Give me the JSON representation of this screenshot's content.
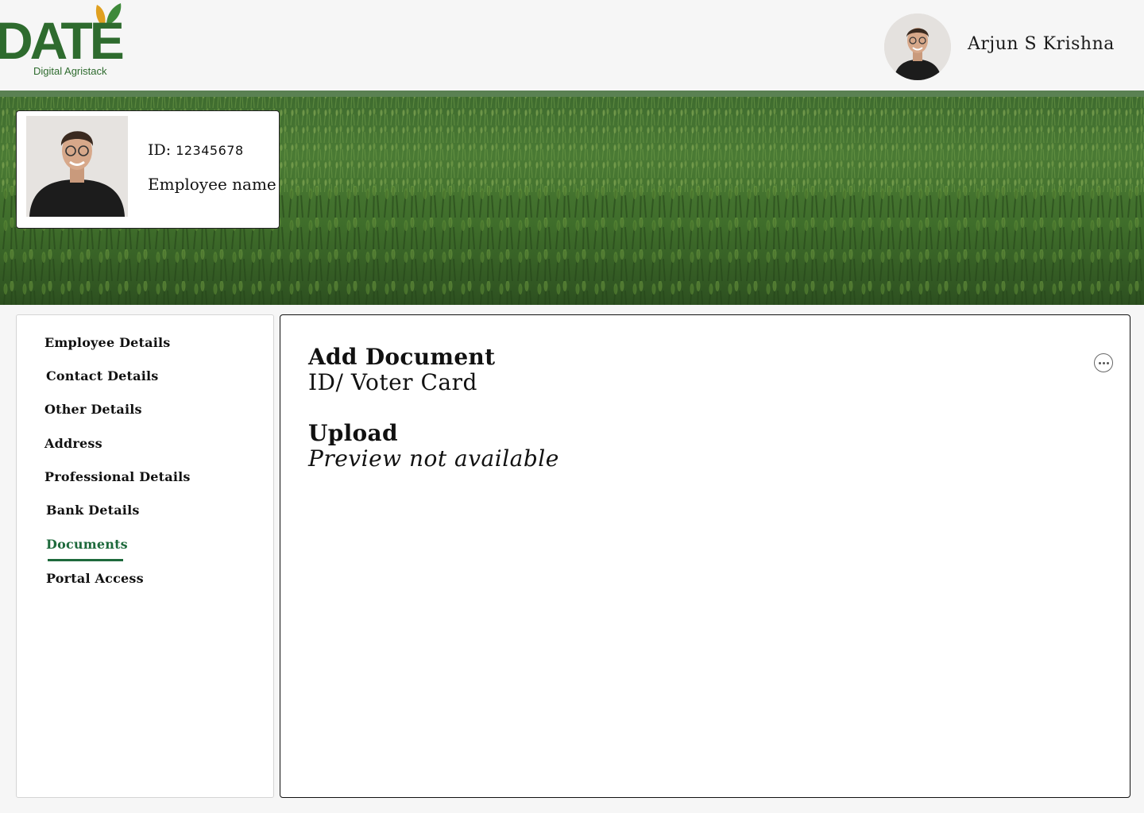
{
  "brand": {
    "logo_text": "DATE",
    "logo_subtitle": "Digital Agristack",
    "logo_color": "#2e6b2e",
    "leaf_colors": [
      "#e0a020",
      "#3e8a3a"
    ]
  },
  "header": {
    "user_name": "Arjun S Krishna",
    "avatar_icon": "user-avatar"
  },
  "profile_card": {
    "id_label": "ID:",
    "id_value": "12345678",
    "name_label": "Employee name"
  },
  "sidebar": {
    "active_color": "#1e6a3c",
    "items": [
      {
        "label": "Employee Details",
        "active": false
      },
      {
        "label": "Contact Details",
        "active": false
      },
      {
        "label": "Other Details",
        "active": false
      },
      {
        "label": "Address",
        "active": false
      },
      {
        "label": "Professional Details",
        "active": false
      },
      {
        "label": "Bank Details",
        "active": false
      },
      {
        "label": "Documents",
        "active": true
      },
      {
        "label": "Portal Access",
        "active": false
      }
    ]
  },
  "panel": {
    "title": "Add Document",
    "subtitle": "ID/ Voter Card",
    "upload_label": "Upload",
    "preview_text": "Preview not available",
    "more_icon": "more-options-icon"
  }
}
